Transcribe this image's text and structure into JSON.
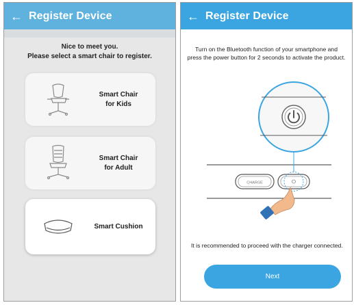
{
  "left_screen": {
    "header": {
      "title": "Register Device",
      "back_icon": "arrow-left-icon"
    },
    "intro": {
      "line1": "Nice to meet you.",
      "line2": "Please select a smart chair to register."
    },
    "options": [
      {
        "line1": "Smart Chair",
        "line2": "for Kids",
        "icon": "kids-chair-icon"
      },
      {
        "line1": "Smart Chair",
        "line2": "for Adult",
        "icon": "adult-chair-icon"
      },
      {
        "line1": "Smart Cushion",
        "line2": "",
        "icon": "cushion-icon",
        "selected": true
      }
    ]
  },
  "right_screen": {
    "header": {
      "title": "Register Device",
      "back_icon": "arrow-left-icon"
    },
    "instruction": {
      "line1": "Turn on the Bluetooth function of your smartphone and",
      "line2": "press the power button for 2 seconds to activate the product."
    },
    "illustration": {
      "charge_label": "CHARGE",
      "power_icon": "power-icon",
      "hand_icon": "pointing-hand-icon"
    },
    "note": "It is recommended to proceed with the charger connected.",
    "next_button": "Next"
  },
  "colors": {
    "accent": "#3aa5e0",
    "background_left": "#e7e7e7",
    "hand": "#f2b98c",
    "sleeve": "#2f73b6"
  }
}
